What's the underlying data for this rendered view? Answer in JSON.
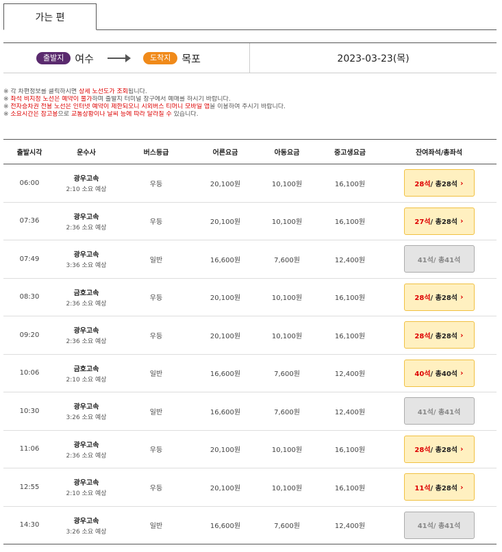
{
  "tab": {
    "label": "가는 편"
  },
  "route": {
    "departure_badge": "출발지",
    "departure_city": "여수",
    "arrival_badge": "도착지",
    "arrival_city": "목포",
    "date": "2023-03-23(목)"
  },
  "notes": [
    [
      "※ 각 차편정보를 클릭하시면 ",
      "상세 노선도가 조회",
      "됩니다."
    ],
    [
      "※ ",
      "좌석 비지정 노선은 예약이 불가",
      "하며 출발지 터미널 창구에서 예매를 하시기 바랍니다."
    ],
    [
      "※ ",
      "전자승차권 전용 노선은 인터넷 예약이 제한되오니 시외버스 티머니 모바일 앱",
      "을 이용하여 주시기 바랍니다."
    ],
    [
      "※ ",
      "소요시간은 참고용",
      "으로 ",
      "교통상황이나 날씨 등에 따라 달라질 수",
      " 있습니다."
    ]
  ],
  "table": {
    "headers": [
      "출발시각",
      "운수사",
      "버스등급",
      "어른요금",
      "아동요금",
      "중고생요금",
      "잔여좌석/총좌석"
    ],
    "seat_separator": " / 총 ",
    "rows": [
      {
        "time": "06:00",
        "operator": "광우고속",
        "duration": "2:10 소요 예상",
        "grade": "우등",
        "adult": "20,100원",
        "child": "10,100원",
        "student": "16,100원",
        "remaining": "28석",
        "total": "28석",
        "available": true
      },
      {
        "time": "07:36",
        "operator": "광우고속",
        "duration": "2:36 소요 예상",
        "grade": "우등",
        "adult": "20,100원",
        "child": "10,100원",
        "student": "16,100원",
        "remaining": "27석",
        "total": "28석",
        "available": true
      },
      {
        "time": "07:49",
        "operator": "광우고속",
        "duration": "3:36 소요 예상",
        "grade": "일반",
        "adult": "16,600원",
        "child": "7,600원",
        "student": "12,400원",
        "remaining": "41석",
        "total": "41석",
        "available": false
      },
      {
        "time": "08:30",
        "operator": "금호고속",
        "duration": "2:36 소요 예상",
        "grade": "우등",
        "adult": "20,100원",
        "child": "10,100원",
        "student": "16,100원",
        "remaining": "28석",
        "total": "28석",
        "available": true
      },
      {
        "time": "09:20",
        "operator": "광우고속",
        "duration": "2:36 소요 예상",
        "grade": "우등",
        "adult": "20,100원",
        "child": "10,100원",
        "student": "16,100원",
        "remaining": "28석",
        "total": "28석",
        "available": true
      },
      {
        "time": "10:06",
        "operator": "금호고속",
        "duration": "2:10 소요 예상",
        "grade": "일반",
        "adult": "16,600원",
        "child": "7,600원",
        "student": "12,400원",
        "remaining": "40석",
        "total": "40석",
        "available": true
      },
      {
        "time": "10:30",
        "operator": "광우고속",
        "duration": "3:26 소요 예상",
        "grade": "일반",
        "adult": "16,600원",
        "child": "7,600원",
        "student": "12,400원",
        "remaining": "41석",
        "total": "41석",
        "available": false
      },
      {
        "time": "11:06",
        "operator": "광우고속",
        "duration": "2:36 소요 예상",
        "grade": "우등",
        "adult": "20,100원",
        "child": "10,100원",
        "student": "16,100원",
        "remaining": "28석",
        "total": "28석",
        "available": true
      },
      {
        "time": "12:55",
        "operator": "광우고속",
        "duration": "2:10 소요 예상",
        "grade": "우등",
        "adult": "20,100원",
        "child": "10,100원",
        "student": "16,100원",
        "remaining": "11석",
        "total": "28석",
        "available": true
      },
      {
        "time": "14:30",
        "operator": "광우고속",
        "duration": "3:26 소요 예상",
        "grade": "일반",
        "adult": "16,600원",
        "child": "7,600원",
        "student": "12,400원",
        "remaining": "41석",
        "total": "41석",
        "available": false
      }
    ]
  },
  "colors": {
    "departure_badge": "#5a2a6e",
    "arrival_badge": "#f08a1a",
    "highlight": "#d00000",
    "seat_available_bg": "#fff0c0",
    "seat_full_bg": "#e4e4e4"
  },
  "icons": {
    "route_arrow": "right-arrow-icon",
    "seat_chevron": "chevron-right-icon"
  }
}
